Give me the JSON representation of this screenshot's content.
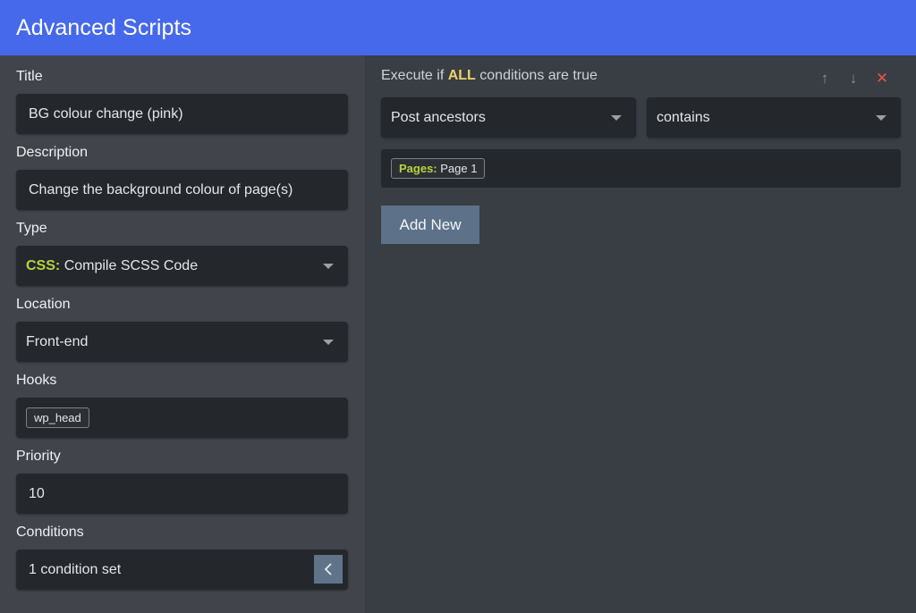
{
  "header": {
    "title": "Advanced Scripts"
  },
  "form": {
    "title": {
      "label": "Title",
      "value": "BG colour change (pink)"
    },
    "description": {
      "label": "Description",
      "value": "Change the background colour of page(s)"
    },
    "type": {
      "label": "Type",
      "prefix": "CSS:",
      "value": "Compile SCSS Code"
    },
    "location": {
      "label": "Location",
      "value": "Front-end"
    },
    "hooks": {
      "label": "Hooks",
      "tags": [
        "wp_head"
      ]
    },
    "priority": {
      "label": "Priority",
      "value": "10"
    },
    "conditions": {
      "label": "Conditions",
      "value": "1 condition set",
      "collapse_icon": "chevron-left-icon"
    }
  },
  "conditions_panel": {
    "header_prefix": "Execute if",
    "header_keyword": "ALL",
    "header_suffix": "conditions are true",
    "actions": {
      "move_up": "↑",
      "move_down": "↓",
      "delete": "✕"
    },
    "condition": {
      "field": "Post ancestors",
      "operator": "contains",
      "value_tag": {
        "prefix": "Pages:",
        "value": "Page 1"
      }
    },
    "add_button": "Add New"
  },
  "colors": {
    "header": "#4669ec",
    "accent_green": "#b6d43b",
    "accent_yellow": "#efd36a",
    "delete_red": "#e5534b",
    "button": "#5d7288"
  }
}
